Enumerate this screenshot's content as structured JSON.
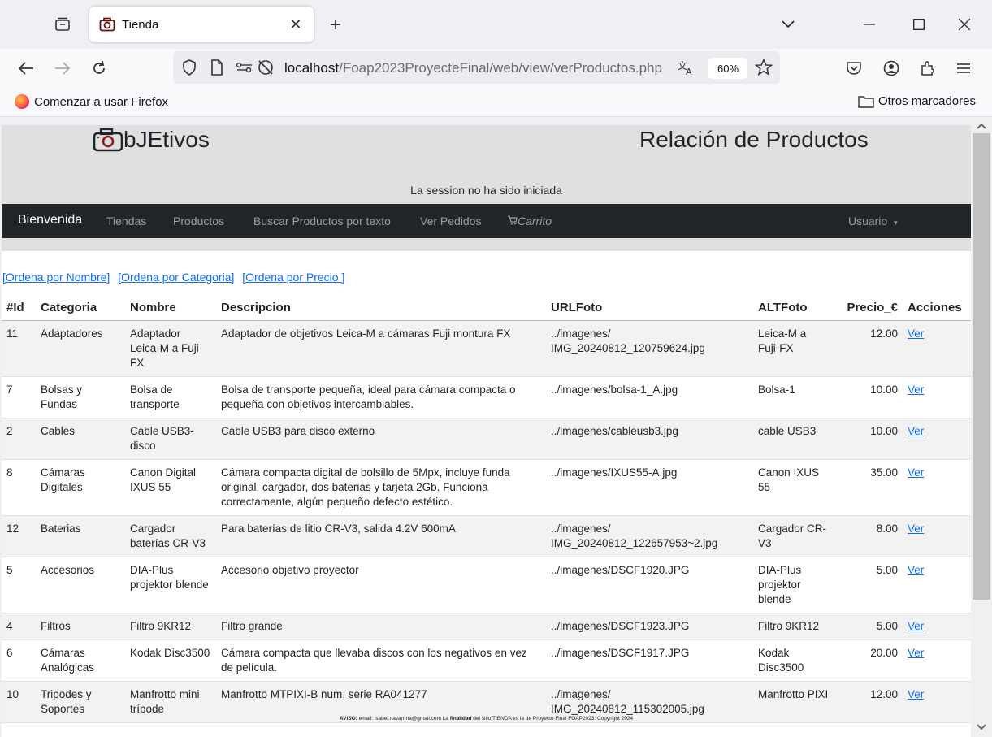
{
  "browser": {
    "tab_title": "Tienda",
    "url_host": "localhost",
    "url_path": "/Foap2023ProyecteFinal/web/view/verProductos.php",
    "zoom": "60%",
    "bookmark_left": "Comenzar a usar Firefox",
    "bookmark_right": "Otros marcadores"
  },
  "page": {
    "logo_text": "bJEtivos",
    "title": "Relación de Productos",
    "session_msg": "La session no ha sido iniciada",
    "nav": {
      "brand": "Bienvenida",
      "items": [
        "Tiendas",
        "Productos",
        "Buscar Productos por texto",
        "Ver Pedidos",
        "Carrito"
      ],
      "user": "Usuario"
    },
    "sort_links": [
      "[Ordena por Nombre]",
      "[Ordena por Categoria]",
      "[Ordena por Precio ]"
    ],
    "table": {
      "headers": [
        "#Id",
        "Categoria",
        "Nombre",
        "Descripcion",
        "URLFoto",
        "ALTFoto",
        "Precio_€",
        "Acciones"
      ],
      "rows": [
        {
          "id": "11",
          "cat": "Adaptadores",
          "name": "Adaptador Leica-M a Fuji FX",
          "desc": "Adaptador de objetivos Leica-M a cámaras Fuji montura FX",
          "url": "../imagenes/ IMG_20240812_120759624.jpg",
          "alt": "Leica-M a Fuji-FX",
          "price": "12.00",
          "action": "Ver"
        },
        {
          "id": "7",
          "cat": "Bolsas y Fundas",
          "name": "Bolsa de transporte",
          "desc": "Bolsa de transporte pequeña, ideal para cámara compacta o pequeña con objetivos intercambiables.",
          "url": "../imagenes/bolsa-1_A.jpg",
          "alt": "Bolsa-1",
          "price": "10.00",
          "action": "Ver"
        },
        {
          "id": "2",
          "cat": "Cables",
          "name": "Cable USB3-disco",
          "desc": "Cable USB3 para disco externo",
          "url": "../imagenes/cableusb3.jpg",
          "alt": "cable USB3",
          "price": "10.00",
          "action": "Ver"
        },
        {
          "id": "8",
          "cat": "Cámaras Digitales",
          "name": "Canon Digital IXUS 55",
          "desc": "Cámara compacta digital de bolsillo de 5Mpx, incluye funda original, cargador, dos baterias y tarjeta 2Gb. Funciona correctamente, algún pequeño defecto estético.",
          "url": "../imagenes/IXUS55-A.jpg",
          "alt": "Canon IXUS 55",
          "price": "35.00",
          "action": "Ver"
        },
        {
          "id": "12",
          "cat": "Baterias",
          "name": "Cargador baterías CR-V3",
          "desc": "Para baterías de litio CR-V3, salida 4.2V 600mA",
          "url": "../imagenes/ IMG_20240812_122657953~2.jpg",
          "alt": "Cargador CR-V3",
          "price": "8.00",
          "action": "Ver"
        },
        {
          "id": "5",
          "cat": "Accesorios",
          "name": "DIA-Plus projektor blende",
          "desc": "Accesorio objetivo proyector",
          "url": "../imagenes/DSCF1920.JPG",
          "alt": "DIA-Plus projektor blende",
          "price": "5.00",
          "action": "Ver"
        },
        {
          "id": "4",
          "cat": "Filtros",
          "name": "Filtro 9KR12",
          "desc": "Filtro grande",
          "url": "../imagenes/DSCF1923.JPG",
          "alt": "Filtro 9KR12",
          "price": "5.00",
          "action": "Ver"
        },
        {
          "id": "6",
          "cat": "Cámaras Analógicas",
          "name": "Kodak Disc3500",
          "desc": "Cámara compacta que llevaba discos con los negativos en vez de película.",
          "url": "../imagenes/DSCF1917.JPG",
          "alt": "Kodak Disc3500",
          "price": "20.00",
          "action": "Ver"
        },
        {
          "id": "10",
          "cat": "Tripodes y Soportes",
          "name": "Manfrotto mini trípode",
          "desc": "Manfrotto MTPIXI-B num. serie RA041277",
          "url": "../imagenes/ IMG_20240812_115302005.jpg",
          "alt": "Manfrotto PIXI",
          "price": "12.00",
          "action": "Ver"
        }
      ]
    },
    "footer": {
      "aviso_label": "AVISO:",
      "email_text": "email: isabel.navarrina@gmail.com La",
      "finalidad": "finalidad",
      "rest": "del sitio TIENDA es la de Proyecto Final FOAP2023. Copyright 2024"
    }
  }
}
